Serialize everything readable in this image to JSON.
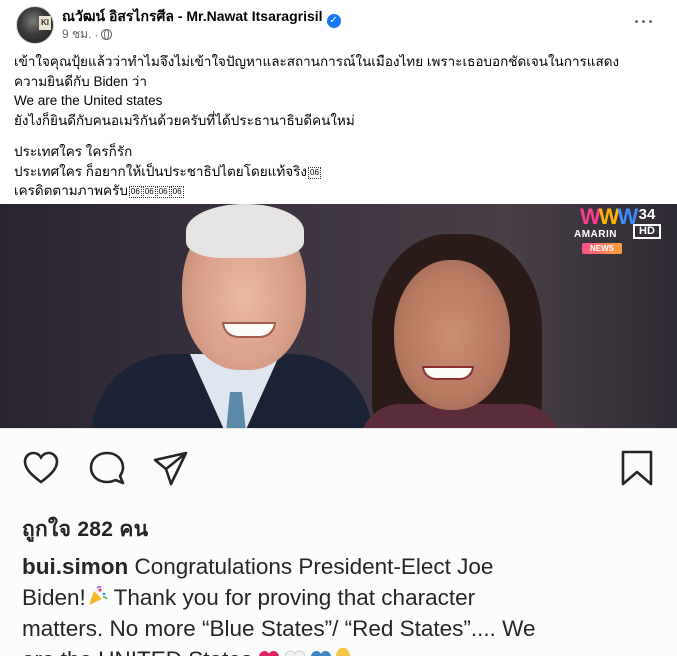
{
  "post": {
    "author": "ณวัฒน์ อิสรไกรศีล - Mr.Nawat Itsaragrisil",
    "time": "9 ชม.",
    "separator": "·",
    "more_icon": "more-horizontal-icon",
    "avatar_badge": "KI",
    "body_lines": [
      "เข้าใจคุณปุ้ยแล้วว่าทำไมจึงไม่เข้าใจปัญหาและสถานการณ์ในเมืองไทย เพราะเธอบอกชัดเจนในการแสดง",
      "ความยินดีกับ Biden ว่า",
      "We are the United states",
      "ยังไงก็ยินดีกับคนอเมริกันด้วยครับที่ได้ประธานาธิบดีคนใหม่"
    ],
    "body_lines_2": [
      "ประเทศใคร ใครก็รัก",
      "ประเทศใคร ก็อยากให้เป็นประชาธิปไตยโดยแท้จริง",
      "เครดิตตามภาพครับ"
    ],
    "unknown_glyph": "06"
  },
  "photo": {
    "brand_name": "AMARIN",
    "brand_sub": "NEWS",
    "channel_number": "34",
    "channel_hd": "HD"
  },
  "instagram": {
    "icons": [
      "heart-icon",
      "comment-icon",
      "share-icon",
      "bookmark-icon"
    ],
    "likes": "ถูกใจ 282 คน",
    "username": "bui.simon",
    "caption_1": " Congratulations President-Elect Joe",
    "caption_2a": "Biden!",
    "caption_2b": " Thank you for proving that character",
    "caption_3": "matters. No more “Blue States”/ “Red States”.... We",
    "caption_4": "are the UNITED States"
  },
  "colors": {
    "verified": "#1877f2",
    "meta_text": "#65676b",
    "ig_text": "#262626"
  }
}
